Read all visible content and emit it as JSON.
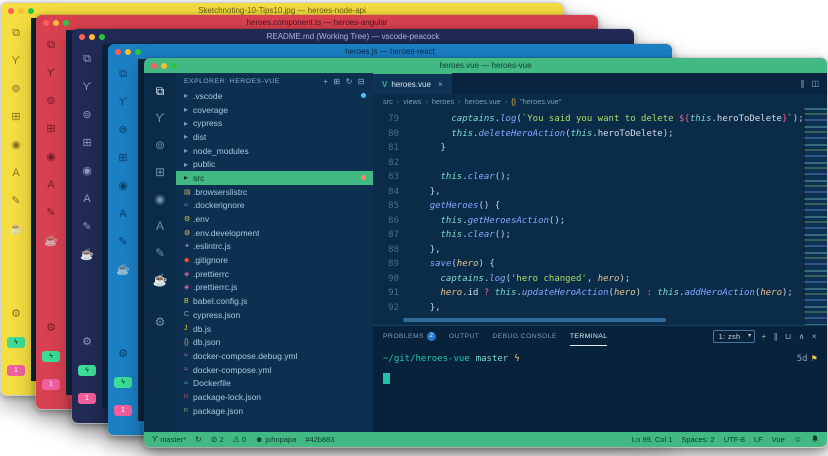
{
  "theme": {
    "editor_bg": "#0a2740",
    "sidebar_bg": "#0d3050",
    "activitybar_bg": "#0a2c49",
    "panel_bg": "#07223a",
    "vue_green": "#42b883"
  },
  "activity_icons": [
    {
      "name": "files-icon",
      "glyph": "⧉"
    },
    {
      "name": "source-control-icon",
      "glyph": "ϒ"
    },
    {
      "name": "debug-icon",
      "glyph": "⊚"
    },
    {
      "name": "extensions-icon",
      "glyph": "⊞"
    },
    {
      "name": "github-icon",
      "glyph": "◉"
    },
    {
      "name": "angular-icon",
      "glyph": "A"
    },
    {
      "name": "edit-icon",
      "glyph": "✎"
    },
    {
      "name": "coffee-icon",
      "glyph": "☕"
    }
  ],
  "settings_gear": {
    "glyph": "⚙"
  },
  "badges": {
    "lightning": {
      "glyph": "ϟ",
      "bg": "#3ddc97",
      "fg": "#072a1c"
    },
    "notification": {
      "label": "1",
      "bg": "#f0609e",
      "fg": "#ffffff"
    }
  },
  "background_windows": [
    {
      "title": "Sketchnoting-10-Tips10.jpg — heroes-node-api",
      "color": "#f5de41",
      "icon_color": "rgba(60,50,0,0.62)",
      "title_color": "rgba(60,50,0,0.78)"
    },
    {
      "title": "heroes.component.ts — heroes-angular",
      "color": "#d8414f",
      "icon_color": "rgba(45,5,20,0.6)",
      "title_color": "rgba(45,5,20,0.8)"
    },
    {
      "title": "README.md (Working Tree) — vscode-peacock",
      "color": "#222b55",
      "icon_color": "#8e9bc4",
      "title_color": "#aab8dd"
    },
    {
      "title": "heroes.js — heroes-react",
      "color": "#1b7fc4",
      "icon_color": "rgba(0,22,45,0.62)",
      "title_color": "rgba(0,22,45,0.82)"
    }
  ],
  "front_window": {
    "title": "heroes.vue — heroes-vue",
    "explorer": {
      "header": "EXPLORER: HEROES-VUE",
      "actions": [
        {
          "name": "new-file-icon",
          "glyph": "+"
        },
        {
          "name": "new-folder-icon",
          "glyph": "⊞"
        },
        {
          "name": "refresh-icon",
          "glyph": "↻"
        },
        {
          "name": "collapse-folders-icon",
          "glyph": "⊟"
        }
      ],
      "files": [
        {
          "name": ".vscode",
          "kind": "folder",
          "dot": "#4fc3f7"
        },
        {
          "name": "coverage",
          "kind": "folder"
        },
        {
          "name": "cypress",
          "kind": "folder"
        },
        {
          "name": "dist",
          "kind": "folder"
        },
        {
          "name": "node_modules",
          "kind": "folder"
        },
        {
          "name": "public",
          "kind": "folder"
        },
        {
          "name": "src",
          "kind": "folder",
          "selected": true,
          "dot": "#ff8c5a"
        },
        {
          "name": ".browserslistrc",
          "kind": "file",
          "icon": "▤",
          "color": "#e0b152"
        },
        {
          "name": ".dockerignore",
          "kind": "file",
          "icon": "≈",
          "color": "#3aa0e8"
        },
        {
          "name": ".env",
          "kind": "file",
          "icon": "⚙",
          "color": "#e8c545"
        },
        {
          "name": ".env.development",
          "kind": "file",
          "icon": "⚙",
          "color": "#e8c545"
        },
        {
          "name": ".eslintrc.js",
          "kind": "file",
          "icon": "✦",
          "color": "#9b7cd4"
        },
        {
          "name": ".gitignore",
          "kind": "file",
          "icon": "◆",
          "color": "#f05033"
        },
        {
          "name": ".prettierrc",
          "kind": "file",
          "icon": "◈",
          "color": "#e06ca8"
        },
        {
          "name": ".prettierrc.js",
          "kind": "file",
          "icon": "◈",
          "color": "#e06ca8"
        },
        {
          "name": "babel.config.js",
          "kind": "file",
          "icon": "B",
          "color": "#e7c437"
        },
        {
          "name": "cypress.json",
          "kind": "file",
          "icon": "C",
          "color": "#69b7a3"
        },
        {
          "name": "db.js",
          "kind": "file",
          "icon": "J",
          "color": "#e7c437"
        },
        {
          "name": "db.json",
          "kind": "file",
          "icon": "{}",
          "color": "#e7a93e"
        },
        {
          "name": "docker-compose.debug.yml",
          "kind": "file",
          "icon": "≈",
          "color": "#e0679f"
        },
        {
          "name": "docker-compose.yml",
          "kind": "file",
          "icon": "≈",
          "color": "#e0679f"
        },
        {
          "name": "Dockerfile",
          "kind": "file",
          "icon": "≈",
          "color": "#3aa0e8"
        },
        {
          "name": "package-lock.json",
          "kind": "file",
          "icon": "n",
          "color": "#c95454"
        },
        {
          "name": "package.json",
          "kind": "file",
          "icon": "n",
          "color": "#73b95c"
        }
      ]
    },
    "editor": {
      "tab": {
        "label": "heroes.vue",
        "icon": "V",
        "close": "×"
      },
      "tab_actions": [
        {
          "name": "split-editor-icon",
          "glyph": "∥"
        },
        {
          "name": "editor-layout-icon",
          "glyph": "◫"
        }
      ],
      "breadcrumbs": [
        {
          "label": "src"
        },
        {
          "label": "views"
        },
        {
          "label": "heroes"
        },
        {
          "label": "heroes.vue"
        },
        {
          "icon": "{}",
          "label": "\"heroes.vue\""
        }
      ],
      "code": [
        {
          "n": 79,
          "s": [
            [
              "d",
              "        "
            ],
            [
              "cy",
              "captains"
            ],
            [
              "pn",
              "."
            ],
            [
              "fn",
              "log"
            ],
            [
              "pn",
              "("
            ],
            [
              "st",
              "`You said you want to delete "
            ],
            [
              "pk",
              "${"
            ],
            [
              "cy",
              "this"
            ],
            [
              "pn",
              "."
            ],
            [
              "d",
              "heroToDelete"
            ],
            [
              "pk",
              "}"
            ],
            [
              "st",
              "`"
            ],
            [
              "pn",
              ");"
            ]
          ]
        },
        {
          "n": 80,
          "s": [
            [
              "d",
              "        "
            ],
            [
              "cy",
              "this"
            ],
            [
              "pn",
              "."
            ],
            [
              "fn",
              "deleteHeroAction"
            ],
            [
              "pn",
              "("
            ],
            [
              "cy",
              "this"
            ],
            [
              "pn",
              "."
            ],
            [
              "d",
              "heroToDelete"
            ],
            [
              "pn",
              ");"
            ]
          ]
        },
        {
          "n": 81,
          "s": [
            [
              "d",
              "      "
            ],
            [
              "pn",
              "}"
            ]
          ]
        },
        {
          "n": 82,
          "s": []
        },
        {
          "n": 83,
          "s": [
            [
              "d",
              "      "
            ],
            [
              "cy",
              "this"
            ],
            [
              "pn",
              "."
            ],
            [
              "fn",
              "clear"
            ],
            [
              "pn",
              "();"
            ]
          ]
        },
        {
          "n": 84,
          "s": [
            [
              "d",
              "    "
            ],
            [
              "pn",
              "},"
            ]
          ]
        },
        {
          "n": 85,
          "s": [
            [
              "d",
              "    "
            ],
            [
              "fn",
              "getHeroes"
            ],
            [
              "pn",
              "() {"
            ]
          ]
        },
        {
          "n": 86,
          "s": [
            [
              "d",
              "      "
            ],
            [
              "cy",
              "this"
            ],
            [
              "pn",
              "."
            ],
            [
              "fn",
              "getHeroesAction"
            ],
            [
              "pn",
              "();"
            ]
          ]
        },
        {
          "n": 87,
          "s": [
            [
              "d",
              "      "
            ],
            [
              "cy",
              "this"
            ],
            [
              "pn",
              "."
            ],
            [
              "fn",
              "clear"
            ],
            [
              "pn",
              "();"
            ]
          ]
        },
        {
          "n": 88,
          "s": [
            [
              "d",
              "    "
            ],
            [
              "pn",
              "},"
            ]
          ]
        },
        {
          "n": 89,
          "s": [
            [
              "d",
              "    "
            ],
            [
              "fn",
              "save"
            ],
            [
              "pn",
              "("
            ],
            [
              "pr",
              "hero"
            ],
            [
              "pn",
              ") {"
            ]
          ]
        },
        {
          "n": 90,
          "s": [
            [
              "d",
              "      "
            ],
            [
              "cy",
              "captains"
            ],
            [
              "pn",
              "."
            ],
            [
              "fn",
              "log"
            ],
            [
              "pn",
              "("
            ],
            [
              "st",
              "'hero changed'"
            ],
            [
              "pn",
              ", "
            ],
            [
              "pr",
              "hero"
            ],
            [
              "pn",
              ");"
            ]
          ]
        },
        {
          "n": 91,
          "s": [
            [
              "d",
              "      "
            ],
            [
              "pr",
              "hero"
            ],
            [
              "pn",
              "."
            ],
            [
              "d",
              "id"
            ],
            [
              "pk",
              " ? "
            ],
            [
              "cy",
              "this"
            ],
            [
              "pn",
              "."
            ],
            [
              "fn",
              "updateHeroAction"
            ],
            [
              "pn",
              "("
            ],
            [
              "pr",
              "hero"
            ],
            [
              "pn",
              ")"
            ],
            [
              "pk",
              " : "
            ],
            [
              "cy",
              "this"
            ],
            [
              "pn",
              "."
            ],
            [
              "fn",
              "addHeroAction"
            ],
            [
              "pn",
              "("
            ],
            [
              "pr",
              "hero"
            ],
            [
              "pn",
              ");"
            ]
          ]
        },
        {
          "n": 92,
          "s": [
            [
              "d",
              "    "
            ],
            [
              "pn",
              "},"
            ]
          ]
        }
      ]
    },
    "panel": {
      "tabs": [
        {
          "label": "PROBLEMS",
          "badge": "2"
        },
        {
          "label": "OUTPUT"
        },
        {
          "label": "DEBUG CONSOLE"
        },
        {
          "label": "TERMINAL",
          "active": true
        }
      ],
      "select_value": "1: zsh",
      "controls": [
        {
          "name": "add-terminal-icon",
          "glyph": "+"
        },
        {
          "name": "split-terminal-icon",
          "glyph": "∥"
        },
        {
          "name": "kill-terminal-icon",
          "glyph": "⊔"
        },
        {
          "name": "maximize-panel-icon",
          "glyph": "∧"
        },
        {
          "name": "close-panel-icon",
          "glyph": "×"
        }
      ]
    },
    "terminal": {
      "cwd": "~/git/heroes-vue",
      "branch": "master",
      "prompt_symbol": "ϟ",
      "age": "5d",
      "flag": "⚑"
    },
    "status_bar": {
      "left": [
        {
          "name": "git-branch",
          "icon": "ϒ",
          "label": "master*"
        },
        {
          "name": "sync",
          "icon": "↻",
          "label": ""
        },
        {
          "name": "errors",
          "icon": "⊘",
          "label": "2"
        },
        {
          "name": "warnings",
          "icon": "⚠",
          "label": "0"
        },
        {
          "name": "account",
          "icon": "☻",
          "label": "johnpapa"
        },
        {
          "name": "peacock-color",
          "icon": "",
          "label": "#42b883"
        }
      ],
      "right": [
        {
          "name": "cursor-position",
          "icon": "",
          "label": "Ln 99, Col 1"
        },
        {
          "name": "indentation",
          "icon": "",
          "label": "Spaces: 2"
        },
        {
          "name": "encoding",
          "icon": "",
          "label": "UTF-8"
        },
        {
          "name": "eol",
          "icon": "",
          "label": "LF"
        },
        {
          "name": "language-mode",
          "icon": "",
          "label": "Vue"
        },
        {
          "name": "feedback",
          "icon": "☺",
          "label": ""
        },
        {
          "name": "notifications",
          "icon": "bell",
          "label": ""
        }
      ]
    }
  }
}
